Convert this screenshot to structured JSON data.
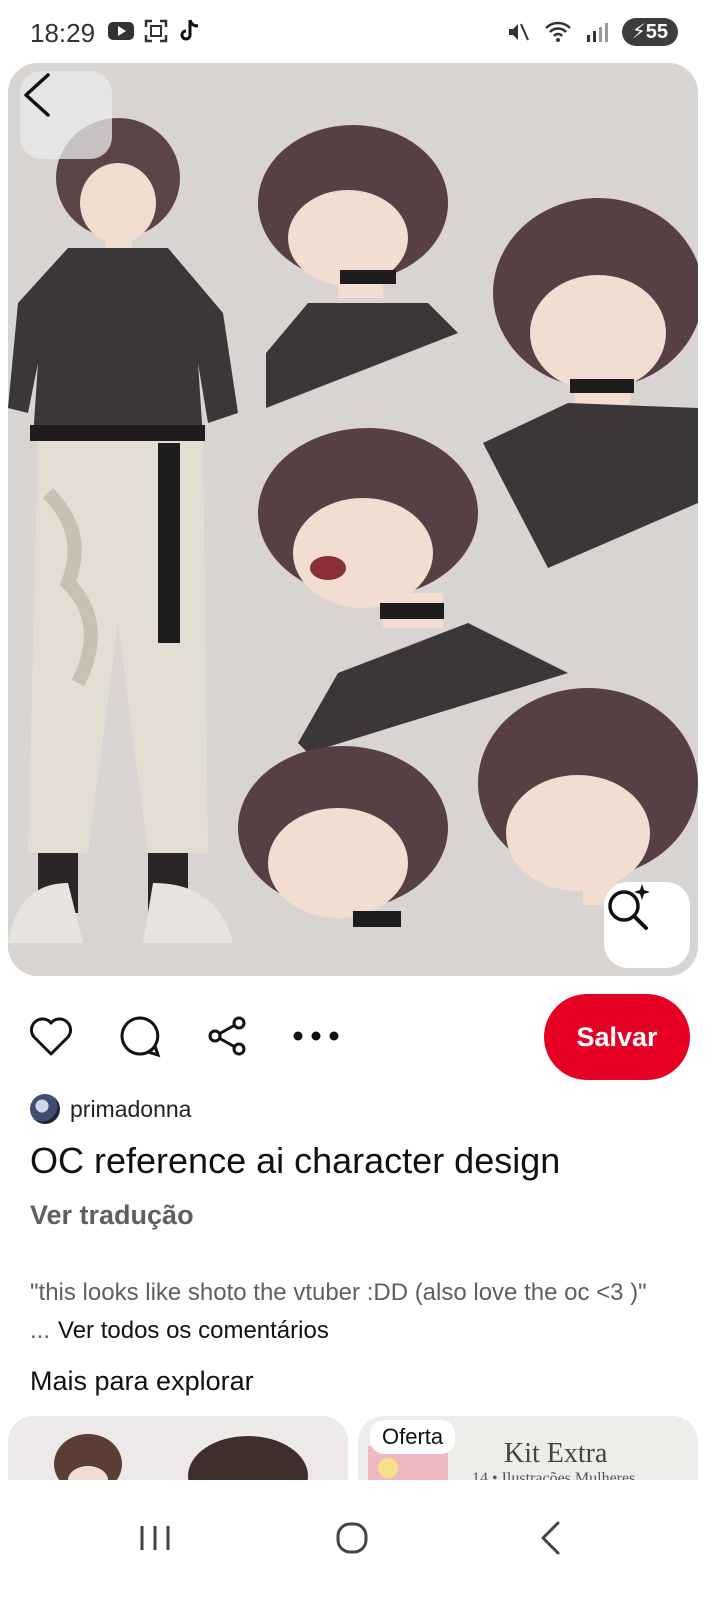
{
  "status_bar": {
    "time": "18:29",
    "battery": "55",
    "icons": [
      "youtube-icon",
      "screenshot-icon",
      "tiktok-icon",
      "mute-icon",
      "wifi-icon",
      "signal-icon",
      "battery-charging-icon"
    ]
  },
  "pin": {
    "image_alt": "",
    "author": "primadonna",
    "title": "OC reference ai character design",
    "translate_label": "Ver tradução",
    "comment_text": "\"this looks like shoto the vtuber :DD (also love the oc <3 )\" ...",
    "see_all_comments": "Ver todos os comentários"
  },
  "actions": {
    "icons": [
      "heart-icon",
      "comment-icon",
      "share-icon",
      "more-icon"
    ],
    "save_label": "Salvar"
  },
  "explore": {
    "title": "Mais para explorar",
    "cards": [
      {
        "tag": ""
      },
      {
        "tag": "Oferta",
        "heading": "Kit Extra",
        "subheading": "14 • Ilustrações Mulheres"
      }
    ]
  },
  "colors": {
    "accent": "#e60023",
    "muted_text": "#5f5f5f",
    "hero_bg": "#d7d3d0"
  }
}
